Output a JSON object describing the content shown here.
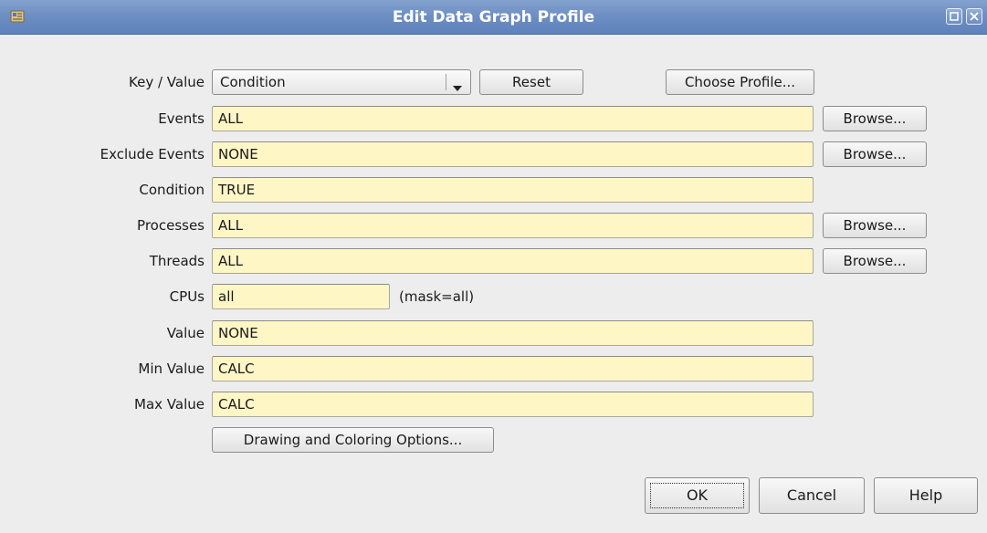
{
  "window": {
    "title": "Edit Data Graph Profile",
    "icons": {
      "app": "app-icon",
      "maximize": "maximize-icon",
      "close": "close-icon"
    },
    "colors": {
      "titlebar": "#6e8fc4",
      "field_background": "#fff6c6",
      "dialog_background": "#ededed"
    }
  },
  "form": {
    "key_value": {
      "label": "Key / Value",
      "selected": "Condition",
      "dropdown_icon": "chevron-down-icon",
      "reset_label": "Reset",
      "choose_profile_label": "Choose Profile..."
    },
    "events": {
      "label": "Events",
      "value": "ALL",
      "browse_label": "Browse..."
    },
    "exclude_events": {
      "label": "Exclude Events",
      "value": "NONE",
      "browse_label": "Browse..."
    },
    "condition": {
      "label": "Condition",
      "value": "TRUE"
    },
    "processes": {
      "label": "Processes",
      "value": "ALL",
      "browse_label": "Browse..."
    },
    "threads": {
      "label": "Threads",
      "value": "ALL",
      "browse_label": "Browse..."
    },
    "cpus": {
      "label": "CPUs",
      "value": "all",
      "mask_note": "(mask=all)"
    },
    "value": {
      "label": "Value",
      "value": "NONE"
    },
    "min_value": {
      "label": "Min Value",
      "value": "CALC"
    },
    "max_value": {
      "label": "Max Value",
      "value": "CALC"
    },
    "drawing_options_label": "Drawing and Coloring Options..."
  },
  "footer": {
    "ok_label": "OK",
    "cancel_label": "Cancel",
    "help_label": "Help"
  }
}
